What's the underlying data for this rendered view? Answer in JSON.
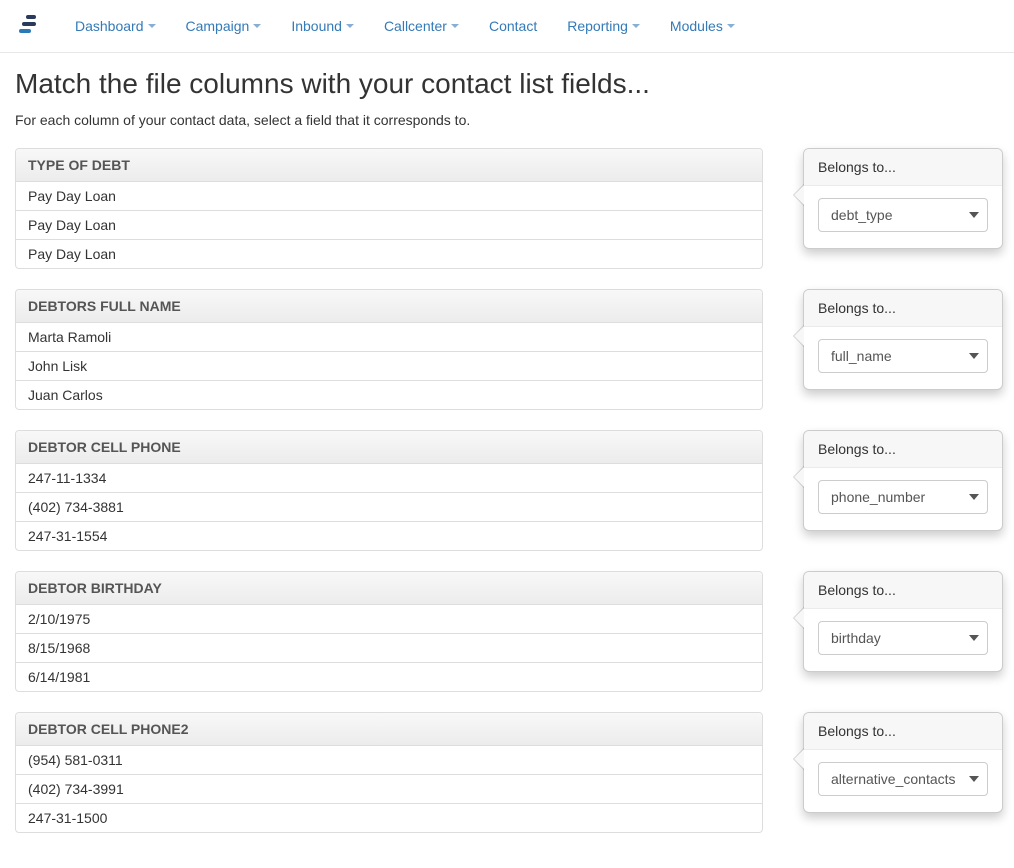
{
  "nav": {
    "items": [
      {
        "label": "Dashboard"
      },
      {
        "label": "Campaign"
      },
      {
        "label": "Inbound"
      },
      {
        "label": "Callcenter"
      },
      {
        "label": "Contact"
      },
      {
        "label": "Reporting"
      },
      {
        "label": "Modules"
      }
    ]
  },
  "page": {
    "title": "Match the file columns with your contact list fields...",
    "subtitle": "For each column of your contact data, select a field that it corresponds to."
  },
  "belongs_to_label": "Belongs to...",
  "columns": [
    {
      "header": "TYPE OF DEBT",
      "rows": [
        "Pay Day Loan",
        "Pay Day Loan",
        "Pay Day Loan"
      ],
      "selected_field": "debt_type"
    },
    {
      "header": "DEBTORS FULL NAME",
      "rows": [
        "Marta Ramoli",
        "John Lisk",
        "Juan Carlos"
      ],
      "selected_field": "full_name"
    },
    {
      "header": "DEBTOR CELL PHONE",
      "rows": [
        "247-11-1334",
        "(402) 734-3881",
        "247-31-1554"
      ],
      "selected_field": "phone_number"
    },
    {
      "header": "DEBTOR BIRTHDAY",
      "rows": [
        "2/10/1975",
        "8/15/1968",
        "6/14/1981"
      ],
      "selected_field": "birthday"
    },
    {
      "header": "DEBTOR CELL PHONE2",
      "rows": [
        "(954) 581-0311",
        "(402) 734-3991",
        "247-31-1500"
      ],
      "selected_field": "alternative_contacts"
    }
  ]
}
